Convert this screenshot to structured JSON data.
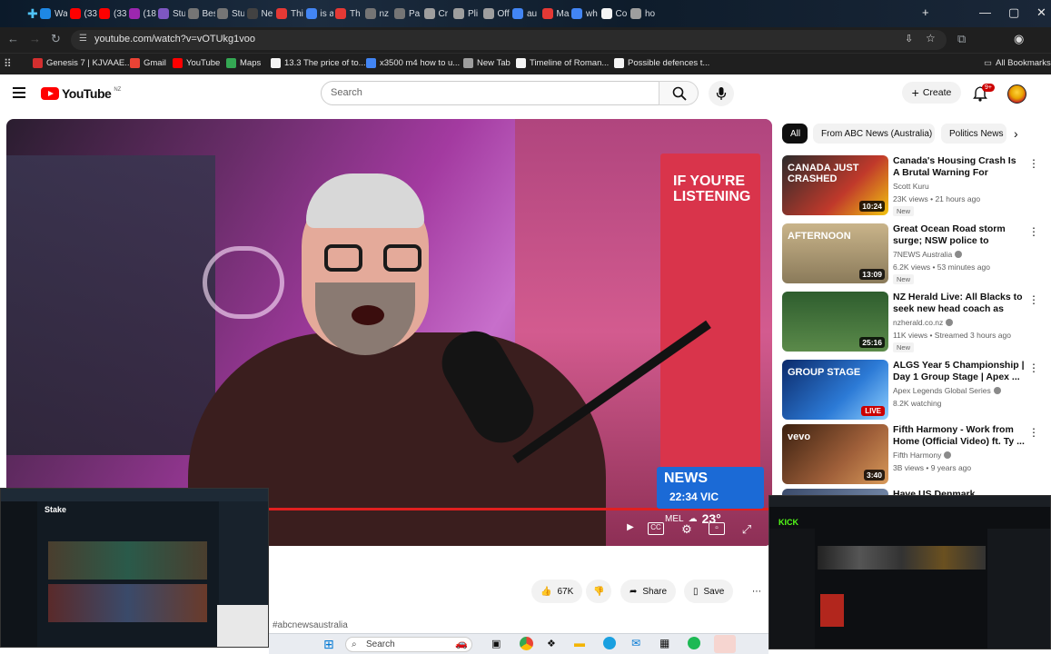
{
  "browser": {
    "tabs": [
      {
        "label": "Wa",
        "color": "#1e88e5"
      },
      {
        "label": "(33",
        "color": "#ff0000"
      },
      {
        "label": "(33",
        "color": "#ff0000"
      },
      {
        "label": "(18",
        "color": "#9c27b0"
      },
      {
        "label": "Stu",
        "color": "#7e57c2"
      },
      {
        "label": "Bes",
        "color": "#757575"
      },
      {
        "label": "Stu",
        "color": "#757575"
      },
      {
        "label": "Ne",
        "color": "#424242"
      },
      {
        "label": "Thi",
        "color": "#e53935"
      },
      {
        "label": "is a",
        "color": "#4285f4"
      },
      {
        "label": "Th",
        "color": "#e53935"
      },
      {
        "label": "nz",
        "color": "#757575"
      },
      {
        "label": "Pa",
        "color": "#757575"
      },
      {
        "label": "Cr",
        "color": "#9e9e9e"
      },
      {
        "label": "Pli",
        "color": "#9e9e9e"
      },
      {
        "label": "Off",
        "color": "#9e9e9e"
      },
      {
        "label": "au",
        "color": "#4285f4"
      },
      {
        "label": "Ma",
        "color": "#e53935"
      },
      {
        "label": "wh",
        "color": "#4285f4"
      },
      {
        "label": "Co",
        "color": "#f5f5f5"
      },
      {
        "label": "ho",
        "color": "#9e9e9e"
      }
    ],
    "url": "youtube.com/watch?v=vOTUkg1voo",
    "bookmarks": [
      {
        "label": "Genesis 7 | KJVAAE...",
        "color": "#d32f2f"
      },
      {
        "label": "Gmail",
        "color": "#ea4335"
      },
      {
        "label": "YouTube",
        "color": "#ff0000"
      },
      {
        "label": "Maps",
        "color": "#34a853"
      },
      {
        "label": "13.3 The price of to...",
        "color": "#f5f5f5"
      },
      {
        "label": "x3500 m4 how to u...",
        "color": "#4285f4"
      },
      {
        "label": "New Tab",
        "color": "#9e9e9e"
      },
      {
        "label": "Timeline of Roman...",
        "color": "#f5f5f5"
      },
      {
        "label": "Possible defences t...",
        "color": "#f5f5f5"
      }
    ],
    "all_bookmarks": "All Bookmarks"
  },
  "youtube": {
    "logo_text": "YouTube",
    "region": "NZ",
    "search_placeholder": "Search",
    "create_label": "Create",
    "notif_count": "9+"
  },
  "player": {
    "poster_text": "IF YOU'RE LISTENING",
    "news_title": "NEWS",
    "news_time": "22:34 VIC",
    "weather_city": "MEL",
    "weather_temp": "23°"
  },
  "actions": {
    "likes": "67K",
    "share": "Share",
    "save": "Save",
    "hashtag": "#abcnewsaustralia"
  },
  "chips": [
    "All",
    "From ABC News (Australia)",
    "Politics News"
  ],
  "recommendations": [
    {
      "title": "Canada's Housing Crash Is A Brutal Warning For Australia ...",
      "channel": "Scott Kuru",
      "meta": "23K views • 21 hours ago",
      "badge": "New",
      "duration": "10:24",
      "thumb_text": "CANADA JUST CRASHED"
    },
    {
      "title": "Great Ocean Road storm surge; NSW police to enforce protest ...",
      "channel": "7NEWS Australia",
      "meta": "6.2K views • 53 minutes ago",
      "badge": "New",
      "duration": "13:09",
      "thumb_text": "AFTERNOON"
    },
    {
      "title": "NZ Herald Live: All Blacks to seek new head coach as Scott...",
      "channel": "nzherald.co.nz",
      "meta": "11K views • Streamed 3 hours ago",
      "badge": "New",
      "duration": "25:16",
      "thumb_text": ""
    },
    {
      "title": "ALGS Year 5 Championship | Day 1 Group Stage | Apex ...",
      "channel": "Apex Legends Global Series",
      "meta": "8.2K watching",
      "badge": "",
      "duration": "LIVE",
      "thumb_text": "GROUP STAGE"
    },
    {
      "title": "Fifth Harmony - Work from Home (Official Video) ft. Ty ...",
      "channel": "Fifth Harmony",
      "meta": "3B views • 9 years ago",
      "badge": "",
      "duration": "3:40",
      "thumb_text": "vevo"
    },
    {
      "title": "Have US Denmark Greenland",
      "channel": "",
      "meta": "",
      "badge": "",
      "duration": "",
      "thumb_text": ""
    }
  ],
  "taskbar": {
    "search_label": "Search"
  },
  "overlays": {
    "left_label": "Stake",
    "right_label": "KICK"
  }
}
